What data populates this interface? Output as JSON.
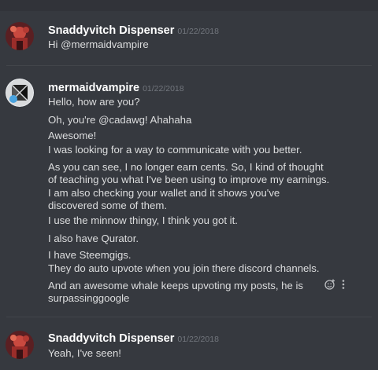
{
  "messages": [
    {
      "username": "Snaddyvitch Dispenser",
      "timestamp": "01/22/2018",
      "lines": [
        "Hi @mermaidvampire"
      ]
    },
    {
      "username": "mermaidvampire",
      "timestamp": "01/22/2018",
      "lines": [
        "Hello, how are you?",
        "Oh, you're @cadawg! Ahahaha",
        "Awesome!",
        "I was looking for a way to communicate with you better.",
        "As you can see, I no longer earn cents. So, I kind of thought of teaching you what I've been using to improve my earnings.",
        "I am also checking your wallet and it shows you've discovered some of them.",
        "I use the minnow thingy, I think you got it.",
        "I also have Qurator.",
        "I have Steemgigs.",
        "They do auto upvote  when you join there discord channels.",
        "And an awesome whale keeps upvoting my posts, he is surpassinggoogle"
      ]
    },
    {
      "username": "Snaddyvitch Dispenser",
      "timestamp": "01/22/2018",
      "lines": [
        "Yeah, I've seen!"
      ]
    }
  ],
  "icons": {
    "reaction": "add-reaction-icon",
    "more": "more-options-icon"
  },
  "colors": {
    "background": "#36393f",
    "username": "#ffffff",
    "text": "#dcddde",
    "timestamp": "#72767d"
  }
}
